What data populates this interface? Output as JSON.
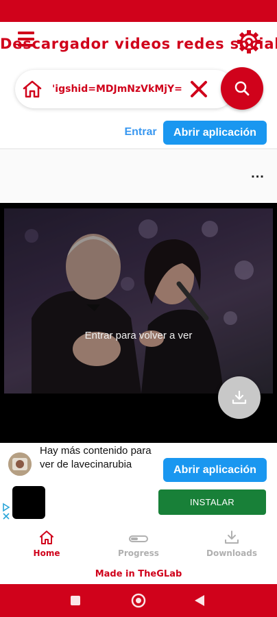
{
  "app": {
    "title": "Descargador videos redes sociales",
    "url_value": "'igshid=MDJmNzVkMjY="
  },
  "post": {
    "login_link": "Entrar",
    "open_app_label": "Abrir aplicación",
    "more_label": "...",
    "video_overlay": "Entrar para volver a ver"
  },
  "ad": {
    "text": "Hay más contenido para ver de lavecinarubia",
    "open_app_label": "Abrir aplicación",
    "install_label": "INSTALAR"
  },
  "nav": {
    "items": [
      {
        "label": "Home",
        "icon": "home-icon",
        "active": true
      },
      {
        "label": "Progress",
        "icon": "progress-icon",
        "active": false
      },
      {
        "label": "Downloads",
        "icon": "download-icon",
        "active": false
      }
    ]
  },
  "footer": {
    "made_in": "Made in TheGLab"
  },
  "colors": {
    "primary": "#d0021b",
    "link_blue": "#3897f0",
    "button_blue": "#1a97f0",
    "install_green": "#188038",
    "inactive_gray": "#b0b0b0"
  }
}
